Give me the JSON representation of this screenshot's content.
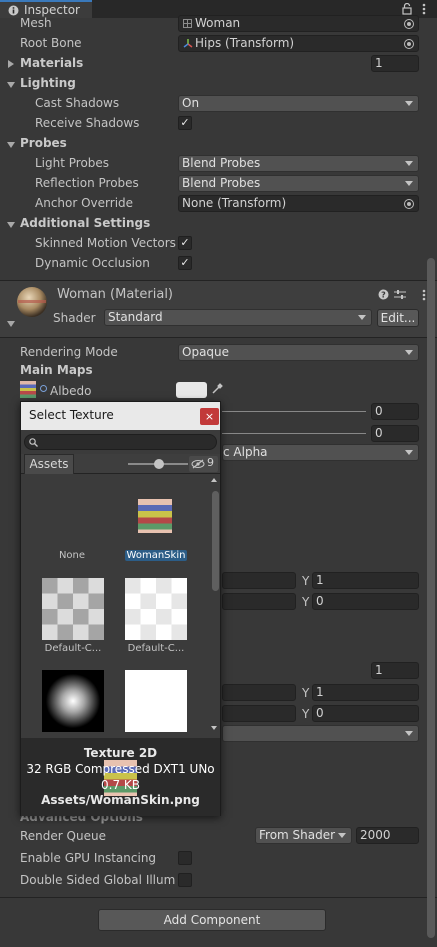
{
  "tab": {
    "title": "Inspector",
    "lock": "lock-icon",
    "menu": "kebab-menu-icon"
  },
  "renderer": {
    "mesh_label": "Mesh",
    "mesh_value": "Woman",
    "root_bone_label": "Root Bone",
    "root_bone_value": "Hips (Transform)",
    "materials_label": "Materials",
    "materials_count": "1",
    "lighting_label": "Lighting",
    "cast_shadows_label": "Cast Shadows",
    "cast_shadows_value": "On",
    "receive_shadows_label": "Receive Shadows",
    "receive_shadows_checked": "✓",
    "probes_label": "Probes",
    "light_probes_label": "Light Probes",
    "light_probes_value": "Blend Probes",
    "reflection_probes_label": "Reflection Probes",
    "reflection_probes_value": "Blend Probes",
    "anchor_override_label": "Anchor Override",
    "anchor_override_value": "None (Transform)",
    "additional_label": "Additional Settings",
    "skinned_motion_label": "Skinned Motion Vectors",
    "skinned_motion_checked": "✓",
    "dynamic_occlusion_label": "Dynamic Occlusion",
    "dynamic_occlusion_checked": "✓"
  },
  "material": {
    "name": "Woman (Material)",
    "shader_label": "Shader",
    "shader_value": "Standard",
    "edit_label": "Edit...",
    "rendering_mode_label": "Rendering Mode",
    "rendering_mode_value": "Opaque",
    "main_maps_label": "Main Maps",
    "albedo_label": "Albedo",
    "slider1_value": "0",
    "slider2_value": "0",
    "source_value": "c Alpha",
    "tiling1_y_label": "Y",
    "tiling1_y": "1",
    "offset1_y_label": "Y",
    "offset1_y": "0",
    "secondary_value": "1",
    "tiling2_y_label": "Y",
    "tiling2_y": "1",
    "offset2_y_label": "Y",
    "offset2_y": "0",
    "advanced_label": "Advanced Options",
    "render_queue_label": "Render Queue",
    "render_queue_mode": "From Shader",
    "render_queue_value": "2000",
    "gpu_instancing_label": "Enable GPU Instancing",
    "double_sided_label": "Double Sided Global Illumina"
  },
  "add_component_label": "Add Component",
  "popup": {
    "title": "Select Texture",
    "close": "×",
    "assets_tab": "Assets",
    "hidden_count": "9",
    "items": [
      {
        "label": "None"
      },
      {
        "label": "WomanSkin",
        "selected": true
      },
      {
        "label": "Default-C..."
      },
      {
        "label": "Default-C..."
      }
    ],
    "preview": {
      "line1": "Texture 2D",
      "line2": "32  RGB Compressed DXT1 UNo",
      "line3": "0.7 KB",
      "line4": "Assets/WomanSkin.png"
    }
  }
}
